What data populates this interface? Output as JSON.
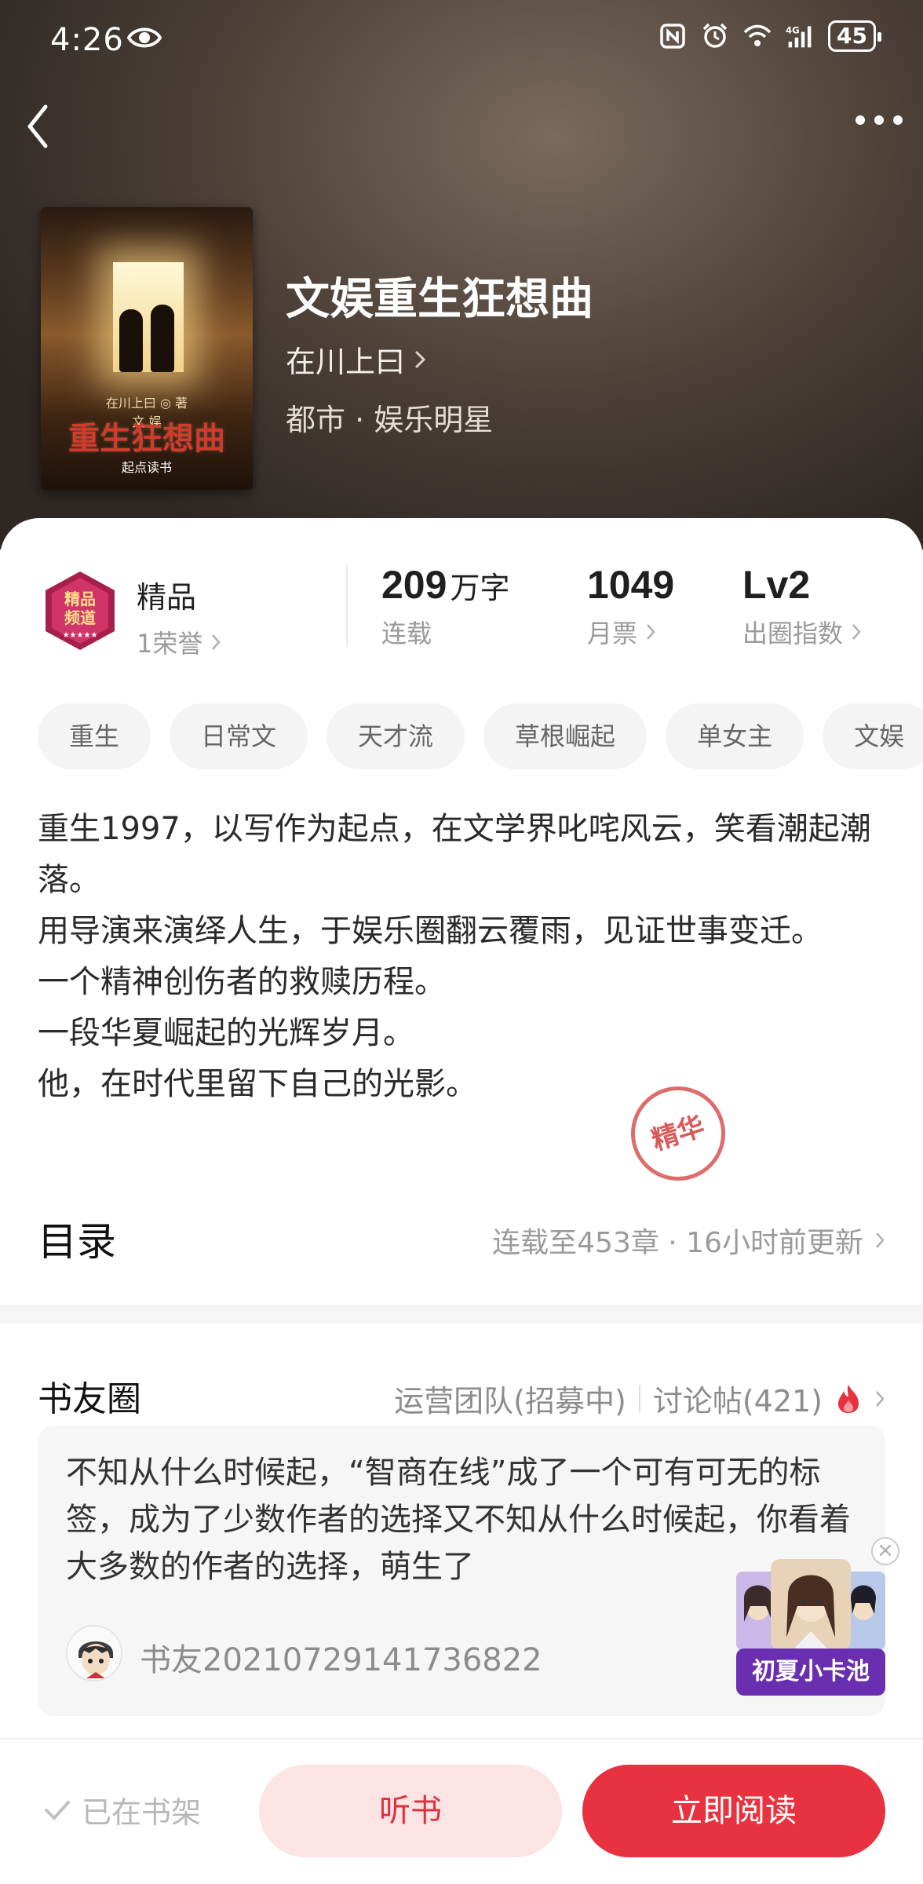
{
  "status_bar": {
    "time": "4:26",
    "battery": "45"
  },
  "book": {
    "title": "文娱重生狂想曲",
    "author": "在川上曰",
    "genre": "都市 · 娱乐明星",
    "cover": {
      "subtitle": "文 娱",
      "title": "重生狂想曲",
      "author_line": "在川上曰 ◎ 著",
      "brand": "起点读书"
    }
  },
  "stats": {
    "quality_title": "精品",
    "quality_sub": "1荣誉",
    "badge_text": "精品频道",
    "words_value": "209",
    "words_unit": "万字",
    "words_label": "连载",
    "tickets_value": "1049",
    "tickets_label": "月票",
    "level_value": "Lv2",
    "level_label": "出圈指数"
  },
  "tags": [
    "重生",
    "日常文",
    "天才流",
    "草根崛起",
    "单女主",
    "文娱"
  ],
  "description": [
    "重生1997，以写作为起点，在文学界叱咤风云，笑看潮起潮落。",
    "用导演来演绎人生，于娱乐圈翻云覆雨，见证世事变迁。",
    "一个精神创伤者的救赎历程。",
    "一段华夏崛起的光辉岁月。",
    "他，在时代里留下自己的光影。"
  ],
  "toc": {
    "title": "目录",
    "info": "连载至453章 · 16小时前更新"
  },
  "circle": {
    "title": "书友圈",
    "team": "运营团队(招募中)",
    "posts_link": "讨论帖(421)",
    "post_text": "不知从什么时候起，“智商在线”成了一个可有可无的标签，成为了少数作者的选择又不知从什么时候起，你看着大多数的作者的选择，萌生了",
    "post_user": "书友20210729141736822",
    "stamp": "精华"
  },
  "float_ad": {
    "label": "初夏小卡池",
    "close": "×"
  },
  "bottom": {
    "shelf": "已在书架",
    "listen": "听书",
    "read": "立即阅读"
  },
  "colors": {
    "accent": "#e8323f",
    "listen_bg": "#fde4e4",
    "float_label_bg": "#6a2fb0"
  }
}
